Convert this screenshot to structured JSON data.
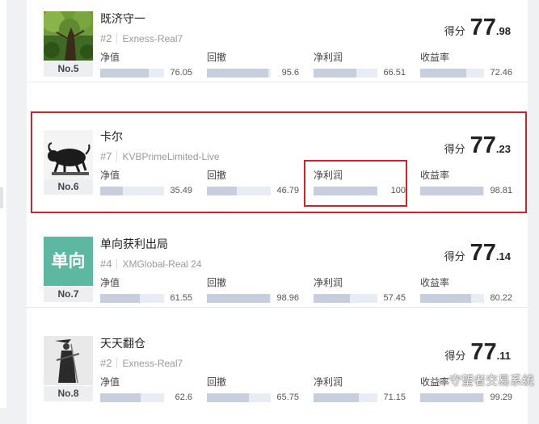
{
  "score_label": "得分",
  "metric_labels": [
    "净值",
    "回撤",
    "净利润",
    "收益率"
  ],
  "cards": [
    {
      "name": "既济守一",
      "rank": "No.5",
      "account_num": "#2",
      "account_name": "Exness-Real7",
      "score_int": "77",
      "score_dec": ".98",
      "avatar": "forest-tree-avatar",
      "metrics": [
        {
          "value": "76.05",
          "fill": 0.76
        },
        {
          "value": "95.6",
          "fill": 0.96
        },
        {
          "value": "66.51",
          "fill": 0.67
        },
        {
          "value": "72.46",
          "fill": 0.72
        }
      ]
    },
    {
      "name": "卡尔",
      "rank": "No.6",
      "account_num": "#7",
      "account_name": "KVBPrimeLimited-Live",
      "score_int": "77",
      "score_dec": ".23",
      "avatar": "bull-sculpture-avatar",
      "highlighted": true,
      "highlighted_metric": "净利润",
      "metrics": [
        {
          "value": "35.49",
          "fill": 0.35
        },
        {
          "value": "46.79",
          "fill": 0.47
        },
        {
          "value": "100",
          "fill": 1.0
        },
        {
          "value": "98.81",
          "fill": 0.99
        }
      ]
    },
    {
      "name": "单向获利出局",
      "rank": "No.7",
      "account_num": "#4",
      "account_name": "XMGlobal-Real 24",
      "score_int": "77",
      "score_dec": ".14",
      "avatar": "text-avatar",
      "avatar_text": "单向",
      "metrics": [
        {
          "value": "61.55",
          "fill": 0.62
        },
        {
          "value": "98.96",
          "fill": 0.99
        },
        {
          "value": "57.45",
          "fill": 0.57
        },
        {
          "value": "80.22",
          "fill": 0.8
        }
      ]
    },
    {
      "name": "天天翻仓",
      "rank": "No.8",
      "account_num": "#2",
      "account_name": "Exness-Real7",
      "score_int": "77",
      "score_dec": ".11",
      "avatar": "swordsman-avatar",
      "metrics": [
        {
          "value": "62.6",
          "fill": 0.63
        },
        {
          "value": "65.75",
          "fill": 0.66
        },
        {
          "value": "71.15",
          "fill": 0.71
        },
        {
          "value": "99.29",
          "fill": 0.99
        }
      ]
    }
  ],
  "watermark": "守望者交易系统",
  "colors": {
    "highlight": "#c8252c",
    "bar_fill": "#c7cfdf",
    "bar_track": "#e8edf5",
    "avatar_text_bg": "#5cb8a0"
  }
}
